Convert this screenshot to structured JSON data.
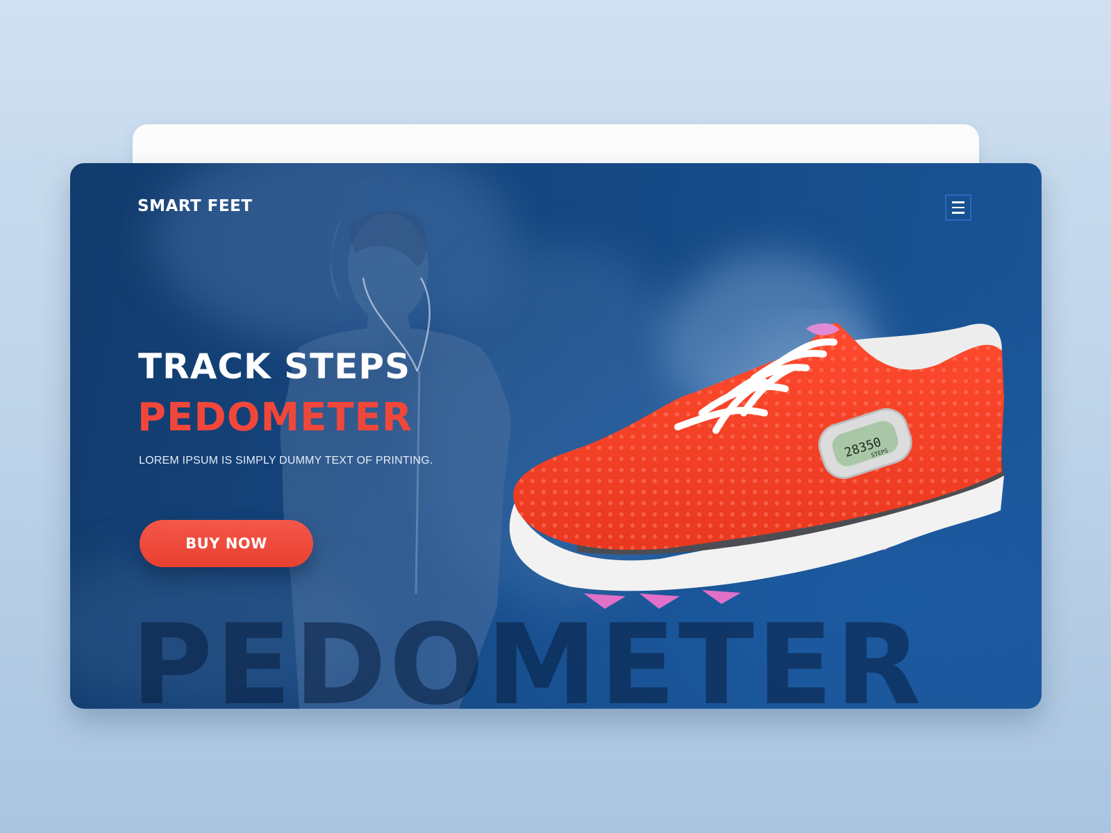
{
  "header": {
    "brand": "SMART FEET",
    "menu_icon": "hamburger-menu-icon"
  },
  "hero": {
    "title_line_1": "TRACK STEPS",
    "title_line_2": "PEDOMETER",
    "tagline": "LOREM IPSUM IS SIMPLY DUMMY TEXT OF PRINTING.",
    "cta_label": "BUY NOW",
    "watermark": "PEDOMETER"
  },
  "product": {
    "display_value": "28350",
    "display_unit": "STEPS"
  },
  "colors": {
    "accent": "#f1473a",
    "hero_dark": "#123b6d",
    "hero_light": "#1a5597",
    "page_bg": "#c7dbef"
  }
}
